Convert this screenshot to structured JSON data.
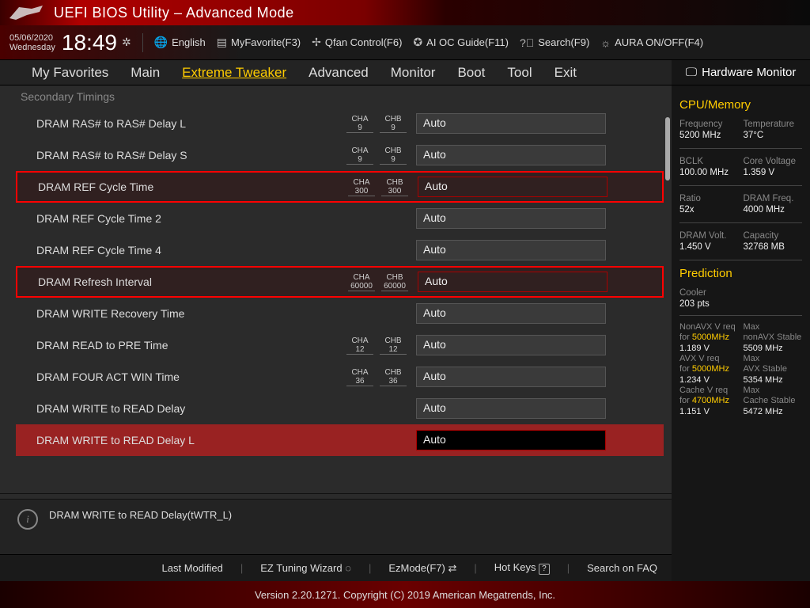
{
  "header": {
    "title": "UEFI BIOS Utility – Advanced Mode",
    "date": "05/06/2020",
    "weekday": "Wednesday",
    "time": "18:49",
    "toolbar": {
      "language": "English",
      "myfavorite": "MyFavorite(F3)",
      "qfan": "Qfan Control(F6)",
      "aioc": "AI OC Guide(F11)",
      "search": "Search(F9)",
      "aura": "AURA ON/OFF(F4)"
    }
  },
  "nav": {
    "tabs": [
      "My Favorites",
      "Main",
      "Extreme Tweaker",
      "Advanced",
      "Monitor",
      "Boot",
      "Tool",
      "Exit"
    ],
    "active": "Extreme Tweaker",
    "hwmon": "Hardware Monitor"
  },
  "settings": {
    "section": "Secondary Timings",
    "rows": [
      {
        "label": "DRAM RAS# to RAS# Delay L",
        "cha": "9",
        "chb": "9",
        "value": "Auto"
      },
      {
        "label": "DRAM RAS# to RAS# Delay S",
        "cha": "9",
        "chb": "9",
        "value": "Auto"
      },
      {
        "label": "DRAM REF Cycle Time",
        "cha": "300",
        "chb": "300",
        "value": "Auto",
        "highlight": true
      },
      {
        "label": "DRAM REF Cycle Time 2",
        "value": "Auto"
      },
      {
        "label": "DRAM REF Cycle Time 4",
        "value": "Auto"
      },
      {
        "label": "DRAM Refresh Interval",
        "cha": "60000",
        "chb": "60000",
        "value": "Auto",
        "highlight": true
      },
      {
        "label": "DRAM WRITE Recovery Time",
        "value": "Auto"
      },
      {
        "label": "DRAM READ to PRE Time",
        "cha": "12",
        "chb": "12",
        "value": "Auto"
      },
      {
        "label": "DRAM FOUR ACT WIN Time",
        "cha": "36",
        "chb": "36",
        "value": "Auto"
      },
      {
        "label": "DRAM WRITE to READ Delay",
        "value": "Auto"
      },
      {
        "label": "DRAM WRITE to READ Delay L",
        "value": "Auto",
        "selected": true
      }
    ],
    "ch_labels": {
      "a": "CHA",
      "b": "CHB"
    },
    "help": "DRAM WRITE to READ Delay(tWTR_L)"
  },
  "side": {
    "cpu_title": "CPU/Memory",
    "stats": [
      {
        "k": "Frequency",
        "v": "5200 MHz"
      },
      {
        "k": "Temperature",
        "v": "37°C"
      },
      {
        "k": "BCLK",
        "v": "100.00 MHz"
      },
      {
        "k": "Core Voltage",
        "v": "1.359 V"
      },
      {
        "k": "Ratio",
        "v": "52x"
      },
      {
        "k": "DRAM Freq.",
        "v": "4000 MHz"
      },
      {
        "k": "DRAM Volt.",
        "v": "1.450 V"
      },
      {
        "k": "Capacity",
        "v": "32768 MB"
      }
    ],
    "pred_title": "Prediction",
    "cooler": {
      "k": "Cooler",
      "v": "203 pts"
    },
    "pred": [
      {
        "k1": "NonAVX V req",
        "k1b": "for ",
        "hl": "5000MHz",
        "k2": "Max nonAVX Stable",
        "v1": "1.189 V",
        "v2": "5509 MHz"
      },
      {
        "k1": "AVX V req",
        "k1b": "for ",
        "hl": "5000MHz",
        "k2": "Max AVX Stable",
        "v1": "1.234 V",
        "v2": "5354 MHz"
      },
      {
        "k1": "Cache V req",
        "k1b": "for ",
        "hl": "4700MHz",
        "k2": "Max Cache Stable",
        "v1": "1.151 V",
        "v2": "5472 MHz"
      }
    ]
  },
  "footer": {
    "links": {
      "last": "Last Modified",
      "eztune": "EZ Tuning Wizard",
      "ezmode": "EzMode(F7)",
      "hotkeys": "Hot Keys",
      "faq": "Search on FAQ"
    },
    "version": "Version 2.20.1271. Copyright (C) 2019 American Megatrends, Inc."
  }
}
